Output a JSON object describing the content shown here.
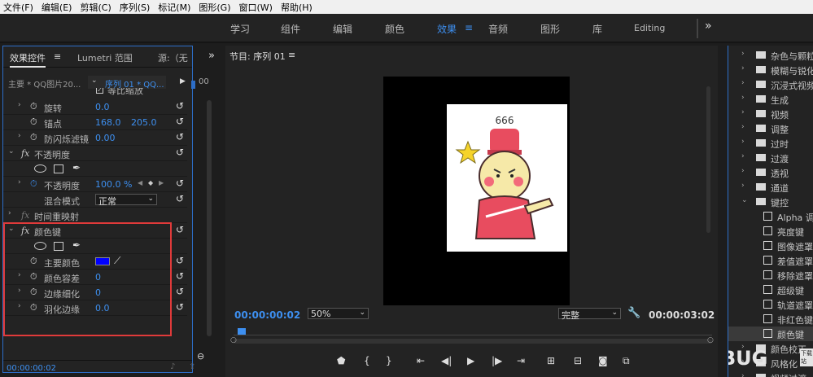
{
  "menu": [
    "文件(F)",
    "编辑(E)",
    "剪辑(C)",
    "序列(S)",
    "标记(M)",
    "图形(G)",
    "窗口(W)",
    "帮助(H)"
  ],
  "workspaces": [
    "学习",
    "组件",
    "编辑",
    "颜色",
    "效果",
    "音频",
    "图形",
    "库",
    "Editing"
  ],
  "workspace_active": "效果",
  "workspace_more": "»",
  "left": {
    "tab_effect_controls": "效果控件",
    "tab_lumetri": "Lumetri 范围",
    "tab_source": "源:（无",
    "more": "»",
    "master": "主要 * QQ图片20...",
    "sequence": "序列 01 * QQ...",
    "timeline_00": "00",
    "partial_row": "等比缩放",
    "rows": {
      "rotation": {
        "label": "旋转",
        "value": "0.0"
      },
      "anchor": {
        "label": "锚点",
        "x": "168.0",
        "y": "205.0"
      },
      "flicker": {
        "label": "防闪烁滤镜",
        "value": "0.00"
      },
      "opacity_group": "不透明度",
      "opacity": {
        "label": "不透明度",
        "value": "100.0 %"
      },
      "blend": {
        "label": "混合模式",
        "value": "正常"
      },
      "time_remap": "时间重映射",
      "color_key": "颜色键",
      "key_color": {
        "label": "主要颜色",
        "color": "#0000ff"
      },
      "tolerance": {
        "label": "颜色容差",
        "value": "0"
      },
      "edge_thin": {
        "label": "边缘细化",
        "value": "0"
      },
      "feather": {
        "label": "羽化边缘",
        "value": "0.0"
      }
    },
    "timecode": "00:00:00:02"
  },
  "monitor": {
    "title": "节目: 序列 01",
    "timecode_current": "00:00:00:02",
    "zoom": "50%",
    "quality": "完整",
    "timecode_duration": "00:00:03:02",
    "sticker_text": "666"
  },
  "effects_list": [
    {
      "type": "folder",
      "label": "杂色与颗粒"
    },
    {
      "type": "folder",
      "label": "模糊与锐化"
    },
    {
      "type": "folder",
      "label": "沉浸式视频"
    },
    {
      "type": "folder",
      "label": "生成"
    },
    {
      "type": "folder",
      "label": "视频"
    },
    {
      "type": "folder",
      "label": "调整"
    },
    {
      "type": "folder",
      "label": "过时"
    },
    {
      "type": "folder",
      "label": "过渡"
    },
    {
      "type": "folder",
      "label": "透视"
    },
    {
      "type": "folder",
      "label": "通道"
    },
    {
      "type": "folder-open",
      "label": "键控"
    },
    {
      "type": "preset",
      "label": "Alpha 调整"
    },
    {
      "type": "preset",
      "label": "亮度键"
    },
    {
      "type": "preset",
      "label": "图像遮罩"
    },
    {
      "type": "preset",
      "label": "差值遮罩"
    },
    {
      "type": "preset",
      "label": "移除遮罩"
    },
    {
      "type": "preset",
      "label": "超级键"
    },
    {
      "type": "preset",
      "label": "轨道遮罩"
    },
    {
      "type": "preset",
      "label": "非红色键"
    },
    {
      "type": "preset-selected",
      "label": "颜色键"
    },
    {
      "type": "folder",
      "label": "颜色校正"
    },
    {
      "type": "folder",
      "label": "风格化"
    },
    {
      "type": "folder",
      "label": "视频过渡"
    }
  ],
  "watermark": "UEBUG",
  "watermark_sub": "下载站",
  "colors": {
    "accent": "#3d8ff0",
    "highlight_box": "#e03a3a",
    "panel": "#232323"
  }
}
